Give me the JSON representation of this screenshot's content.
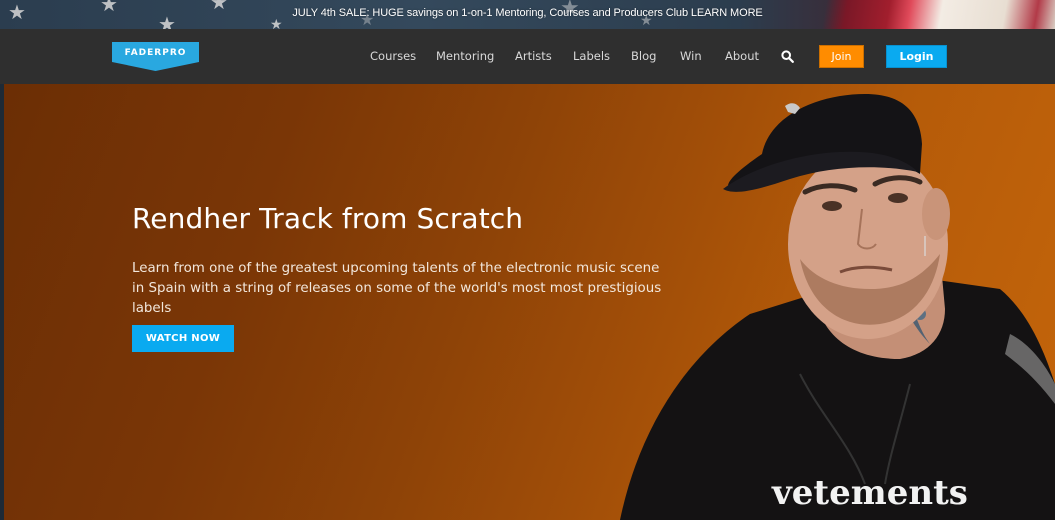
{
  "promo_banner": {
    "text": "JULY 4th SALE: HUGE savings on 1-on-1 Mentoring, Courses and Producers Club LEARN MORE"
  },
  "header": {
    "logo_text": "FADERPRO",
    "nav": [
      {
        "label": "Courses"
      },
      {
        "label": "Mentoring"
      },
      {
        "label": "Artists"
      },
      {
        "label": "Labels"
      },
      {
        "label": "Blog"
      },
      {
        "label": "Win"
      },
      {
        "label": "About"
      }
    ],
    "search_icon": "search-icon",
    "join_label": "Join",
    "login_label": "Login"
  },
  "hero": {
    "title": "Rendher Track from Scratch",
    "description": "Learn from one of the greatest upcoming talents of the electronic music scene in Spain with a string of releases on some of the world's most most prestigious labels",
    "cta_label": "WATCH NOW",
    "shirt_text": "vetements"
  },
  "colors": {
    "nav_bg": "#2f2f2f",
    "brand_blue": "#0aaaf0",
    "join_orange": "#ff8c00",
    "hero_orange": "#a14e08"
  }
}
